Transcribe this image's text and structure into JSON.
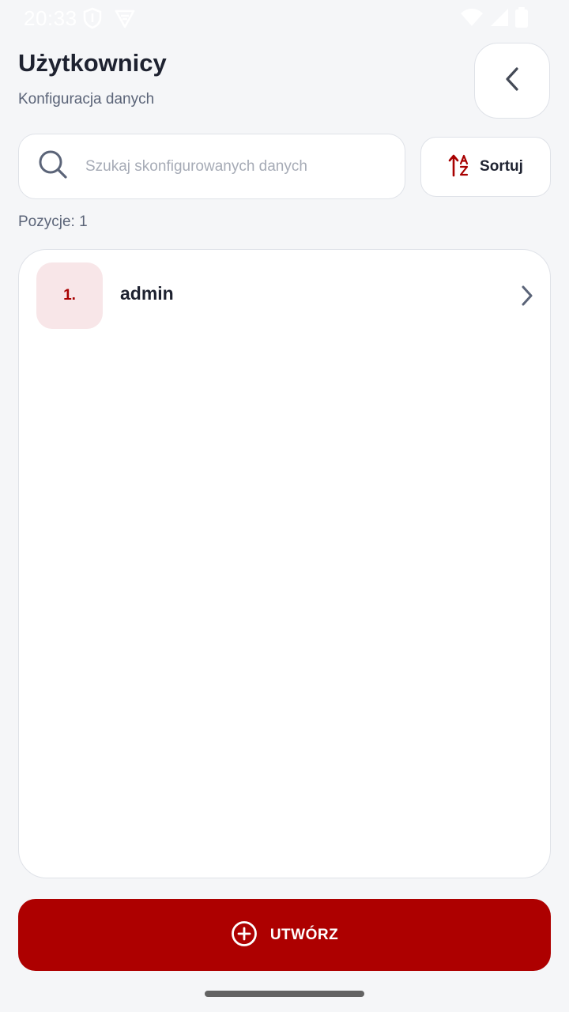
{
  "status_bar": {
    "time": "20:33",
    "left_icons": [
      "shield-icon",
      "vpn-icon"
    ],
    "right_icons": [
      "wifi-icon",
      "signal-icon",
      "battery-icon"
    ]
  },
  "header": {
    "title": "Użytkownicy",
    "subtitle": "Konfiguracja danych",
    "back_icon": "chevron-left-icon"
  },
  "search": {
    "value": "",
    "placeholder": "Szukaj skonfigurowanych danych",
    "icon": "search-icon"
  },
  "sort": {
    "label": "Sortuj",
    "icon": "sort-az-icon"
  },
  "list": {
    "count_label": "Pozycje: 1",
    "items": [
      {
        "index": "1.",
        "name": "admin"
      }
    ]
  },
  "create": {
    "label": "UTWÓRZ",
    "icon": "plus-circle-icon"
  },
  "colors": {
    "accent": "#ad0000",
    "badge_bg": "#f8e6e8",
    "background": "#f5f6f8",
    "text": "#1e2230",
    "muted_text": "#5b6478"
  }
}
